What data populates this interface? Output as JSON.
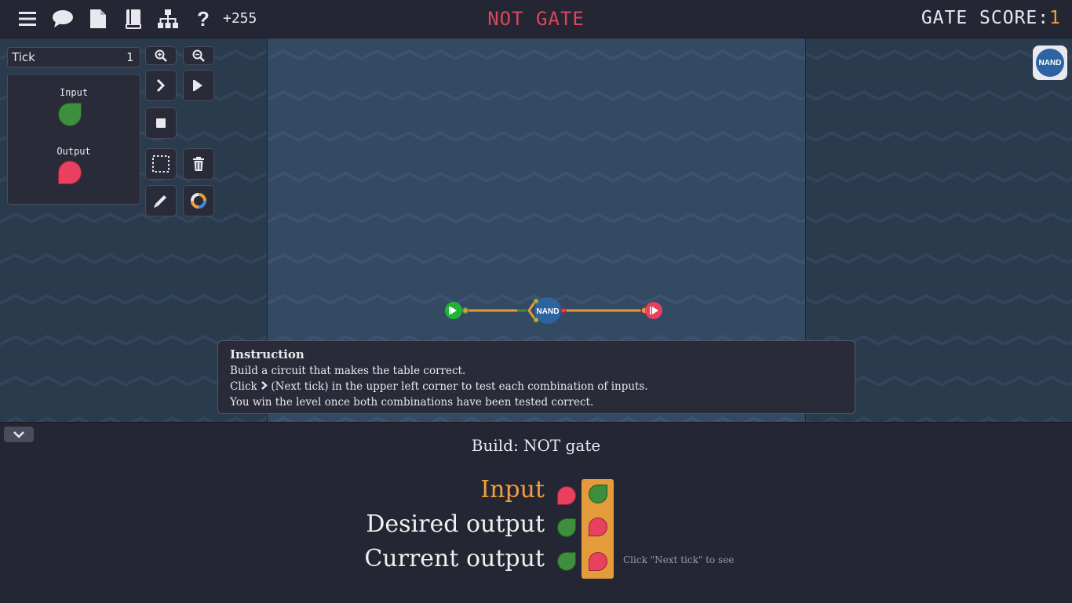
{
  "topbar": {
    "icons": [
      "menu-icon",
      "chat-icon",
      "document-icon",
      "book-icon",
      "hierarchy-icon",
      "help-icon"
    ],
    "credits": "+255",
    "level_title": "NOT GATE",
    "score_label": "GATE SCORE:",
    "score_value": "1"
  },
  "left_panel": {
    "tick_label": "Tick",
    "tick_value": "1",
    "input_label": "Input",
    "output_label": "Output"
  },
  "controls": [
    "zoom-in",
    "zoom-out",
    "next-tick",
    "run",
    "stop",
    "select",
    "delete",
    "pencil",
    "color-wheel"
  ],
  "board": {
    "gate_label": "NAND"
  },
  "palette": {
    "nand_label": "NAND"
  },
  "instruction": {
    "title": "Instruction",
    "line1": "Build a circuit that makes the table correct.",
    "line2_pre": "Click",
    "line2_post": "(Next tick) in the upper left corner to test each combination of inputs.",
    "line3": "You win the level once both combinations have been tested correct."
  },
  "bottom": {
    "build_title": "Build: NOT gate",
    "rows": [
      {
        "label": "Input",
        "values": [
          "off",
          "on"
        ],
        "color": "#f0a040"
      },
      {
        "label": "Desired output",
        "values": [
          "on",
          "off"
        ]
      },
      {
        "label": "Current output",
        "values": [
          "on",
          "off"
        ]
      }
    ],
    "hint": "Click \"Next tick\" to see"
  },
  "colors": {
    "accent_orange": "#f0a040",
    "title_red": "#d9475d",
    "signal_on": "#3d8f3d",
    "signal_off": "#e8405e",
    "wire": "#e39b3c"
  }
}
